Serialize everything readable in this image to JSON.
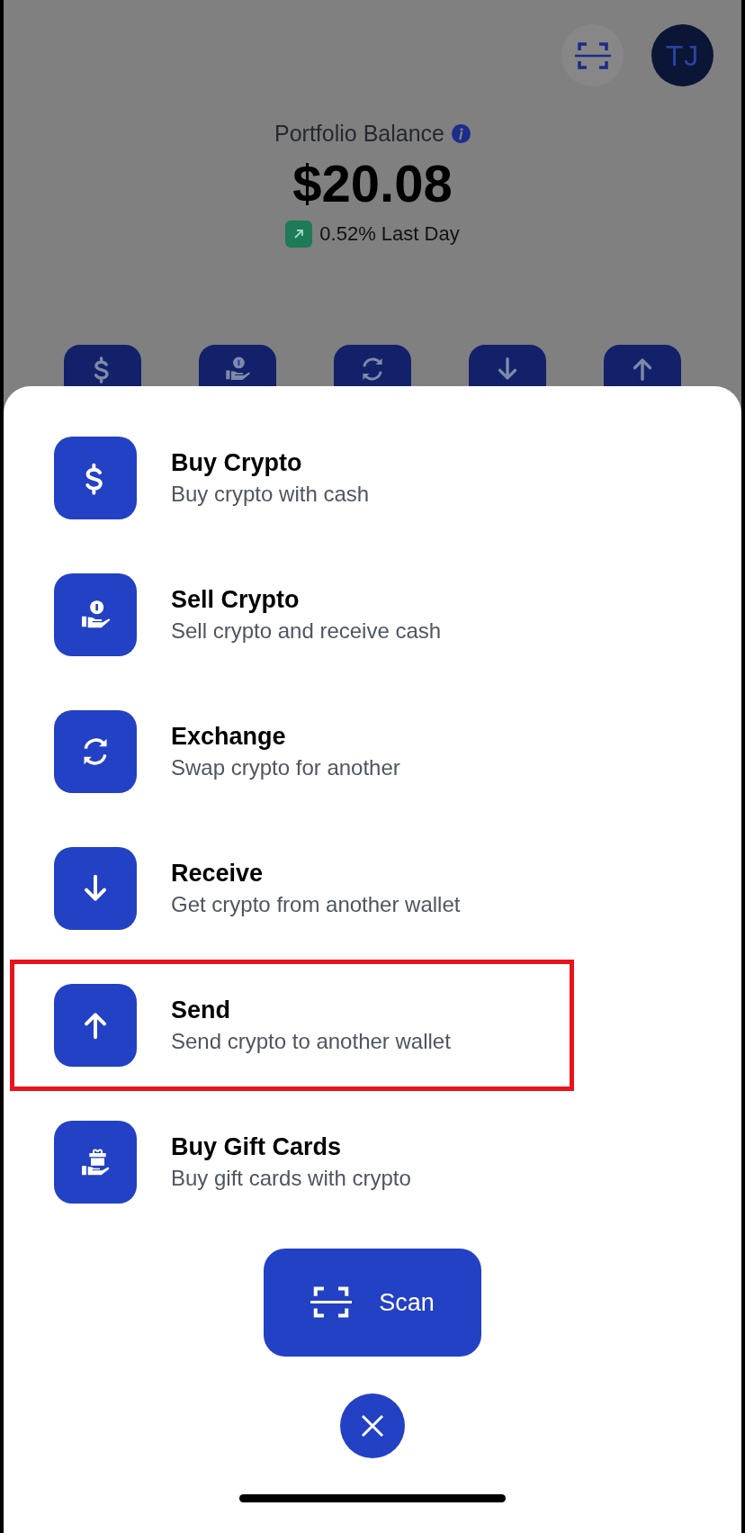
{
  "header": {
    "avatar_initials": "TJ"
  },
  "balance": {
    "label": "Portfolio Balance",
    "amount": "$20.08",
    "change": {
      "kind": "up",
      "text": "0.52% Last Day"
    }
  },
  "quick_actions": [
    {
      "kind": "dollar"
    },
    {
      "kind": "hand-coin"
    },
    {
      "kind": "sync"
    },
    {
      "kind": "arrow-down"
    },
    {
      "kind": "arrow-up"
    }
  ],
  "menu_items": [
    {
      "kind": "dollar",
      "title": "Buy Crypto",
      "subtitle": "Buy crypto with cash",
      "highlighted": false
    },
    {
      "kind": "hand-coin",
      "title": "Sell Crypto",
      "subtitle": "Sell crypto and receive cash",
      "highlighted": false
    },
    {
      "kind": "sync",
      "title": "Exchange",
      "subtitle": "Swap crypto for another",
      "highlighted": false
    },
    {
      "kind": "arrow-down",
      "title": "Receive",
      "subtitle": "Get crypto from another wallet",
      "highlighted": false
    },
    {
      "kind": "arrow-up",
      "title": "Send",
      "subtitle": "Send crypto to another wallet",
      "highlighted": true
    },
    {
      "kind": "gift-hand",
      "title": "Buy Gift Cards",
      "subtitle": "Buy gift cards with crypto",
      "highlighted": false
    }
  ],
  "scan_button": {
    "label": "Scan"
  }
}
